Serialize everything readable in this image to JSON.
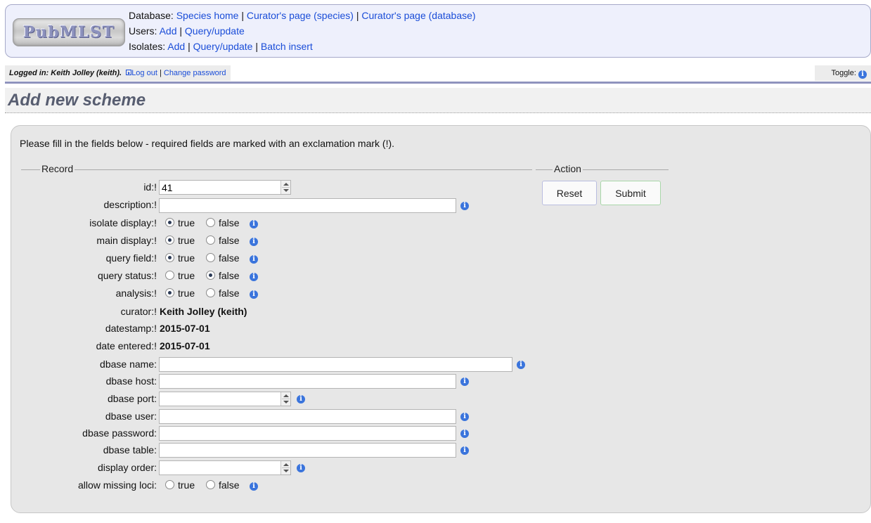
{
  "header": {
    "logo_text": "PubMLST",
    "database_label": "Database:",
    "database_links": [
      "Species home",
      "Curator's page (species)",
      "Curator's page (database)"
    ],
    "users_label": "Users:",
    "users_links": [
      "Add",
      "Query/update"
    ],
    "isolates_label": "Isolates:",
    "isolates_links": [
      "Add",
      "Query/update",
      "Batch insert"
    ]
  },
  "login": {
    "logged_in_text": "Logged in: Keith Jolley (keith).",
    "logout": "Log out",
    "change_password": "Change password",
    "toggle_label": "Toggle:"
  },
  "page": {
    "title": "Add new scheme",
    "intro": "Please fill in the fields below - required fields are marked with an exclamation mark (!).",
    "record_legend": "Record",
    "action_legend": "Action",
    "reset_label": "Reset",
    "submit_label": "Submit"
  },
  "form": {
    "id": {
      "label": "id:!",
      "value": "41"
    },
    "description": {
      "label": "description:!"
    },
    "isolate_display": {
      "label": "isolate display:!",
      "value": "true"
    },
    "main_display": {
      "label": "main display:!",
      "value": "true"
    },
    "query_field": {
      "label": "query field:!",
      "value": "true"
    },
    "query_status": {
      "label": "query status:!",
      "value": "false"
    },
    "analysis": {
      "label": "analysis:!",
      "value": "true"
    },
    "curator": {
      "label": "curator:!",
      "value": "Keith Jolley (keith)"
    },
    "datestamp": {
      "label": "datestamp:!",
      "value": "2015-07-01"
    },
    "date_entered": {
      "label": "date entered:!",
      "value": "2015-07-01"
    },
    "dbase_name": {
      "label": "dbase name:"
    },
    "dbase_host": {
      "label": "dbase host:"
    },
    "dbase_port": {
      "label": "dbase port:"
    },
    "dbase_user": {
      "label": "dbase user:"
    },
    "dbase_password": {
      "label": "dbase password:"
    },
    "dbase_table": {
      "label": "dbase table:"
    },
    "display_order": {
      "label": "display order:"
    },
    "allow_missing_loci": {
      "label": "allow missing loci:",
      "value": ""
    },
    "true_text": "true",
    "false_text": "false"
  },
  "icons": {
    "info": "info-icon",
    "logout": "logout-icon"
  }
}
